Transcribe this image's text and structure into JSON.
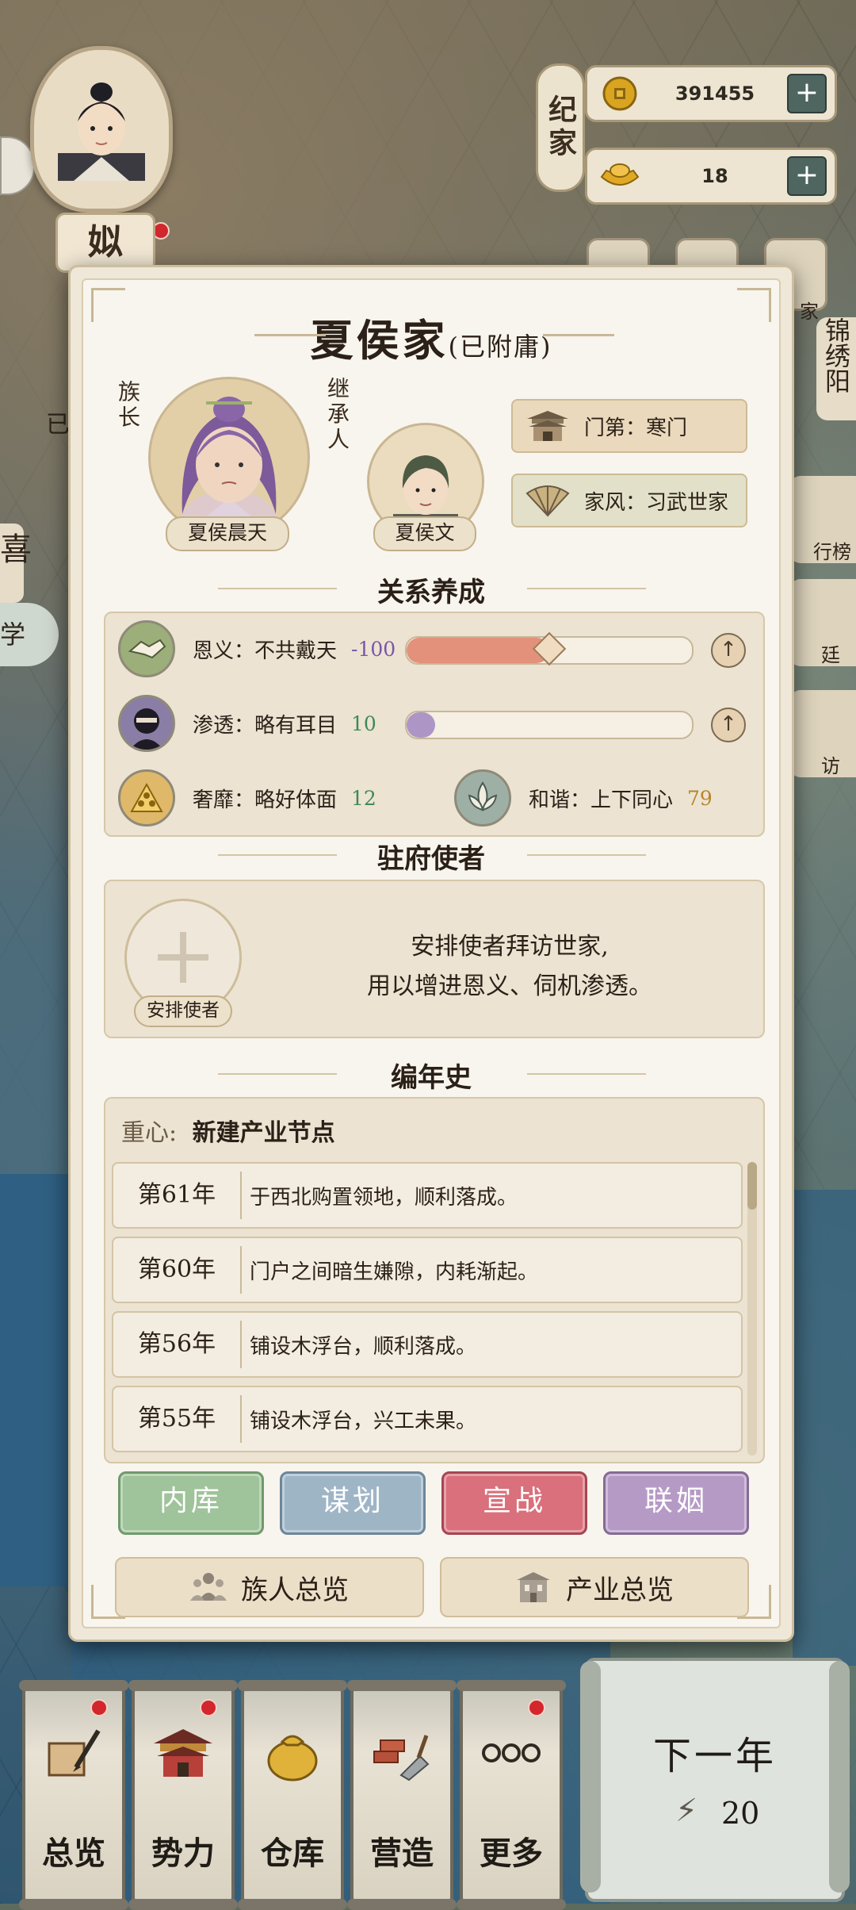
{
  "hud": {
    "player_name_partial": "姒",
    "chronicle_button": "纪家",
    "coins": "391455",
    "gold_ingots": "18",
    "plus": "+"
  },
  "side_buttons": [
    "锦绣阳",
    "行榜",
    "廷",
    "访",
    "家"
  ],
  "left_map_labels": [
    "喜",
    "学",
    "已"
  ],
  "family": {
    "name": "夏侯家",
    "status": "(已附庸)",
    "leader_label": "族长",
    "leader_name": "夏侯晨天",
    "heir_label": "继承人",
    "heir_name": "夏侯文",
    "rank": "门第：寒门",
    "style": "家风：习武世家"
  },
  "relations": {
    "title": "关系养成",
    "gratitude": {
      "label": "恩义：不共戴天",
      "value": "-100",
      "fill": 0.5
    },
    "infiltration": {
      "label": "渗透：略有耳目",
      "value": "10",
      "fill": 0.1
    },
    "luxury": {
      "label": "奢靡：略好体面",
      "value": "12"
    },
    "harmony": {
      "label": "和谐：上下同心",
      "value": "79"
    },
    "up_symbol": "↑"
  },
  "envoy": {
    "title": "驻府使者",
    "button": "安排使者",
    "description_line1": "安排使者拜访世家,",
    "description_line2": "用以增进恩义、伺机渗透。"
  },
  "chronicle": {
    "title": "编年史",
    "focus_label": "重心:",
    "focus_value": "新建产业节点",
    "entries": [
      {
        "year": "第61年",
        "text": "于西北购置领地，顺利落成。"
      },
      {
        "year": "第60年",
        "text": "门户之间暗生嫌隙，内耗渐起。"
      },
      {
        "year": "第56年",
        "text": "铺设木浮台，顺利落成。"
      },
      {
        "year": "第55年",
        "text": "铺设木浮台，兴工未果。"
      }
    ]
  },
  "actions": {
    "treasury": "内库",
    "plot": "谋划",
    "declare_war": "宣战",
    "marriage": "联姻",
    "clan_overview": "族人总览",
    "industry_overview": "产业总览"
  },
  "colors": {
    "treasury": "#9fc39a",
    "plot": "#9eb5c6",
    "declare_war": "#d9707b",
    "marriage": "#b69ac6",
    "gratitude_bar": "#e3917b",
    "infiltration_bar": "#ad96c6",
    "negative_value": "#7b55a8",
    "positive_value": "#3f8a55",
    "harmony_value": "#b8862b"
  },
  "bottom_nav": [
    {
      "label": "总览",
      "icon": "scroll-brush-icon",
      "badge": true
    },
    {
      "label": "势力",
      "icon": "palace-icon",
      "badge": true
    },
    {
      "label": "仓库",
      "icon": "money-bag-icon",
      "badge": false
    },
    {
      "label": "营造",
      "icon": "trowel-bricks-icon",
      "badge": false
    },
    {
      "label": "更多",
      "icon": "more-dots-icon",
      "badge": true
    }
  ],
  "next_year": {
    "label": "下一年",
    "energy": "20"
  }
}
